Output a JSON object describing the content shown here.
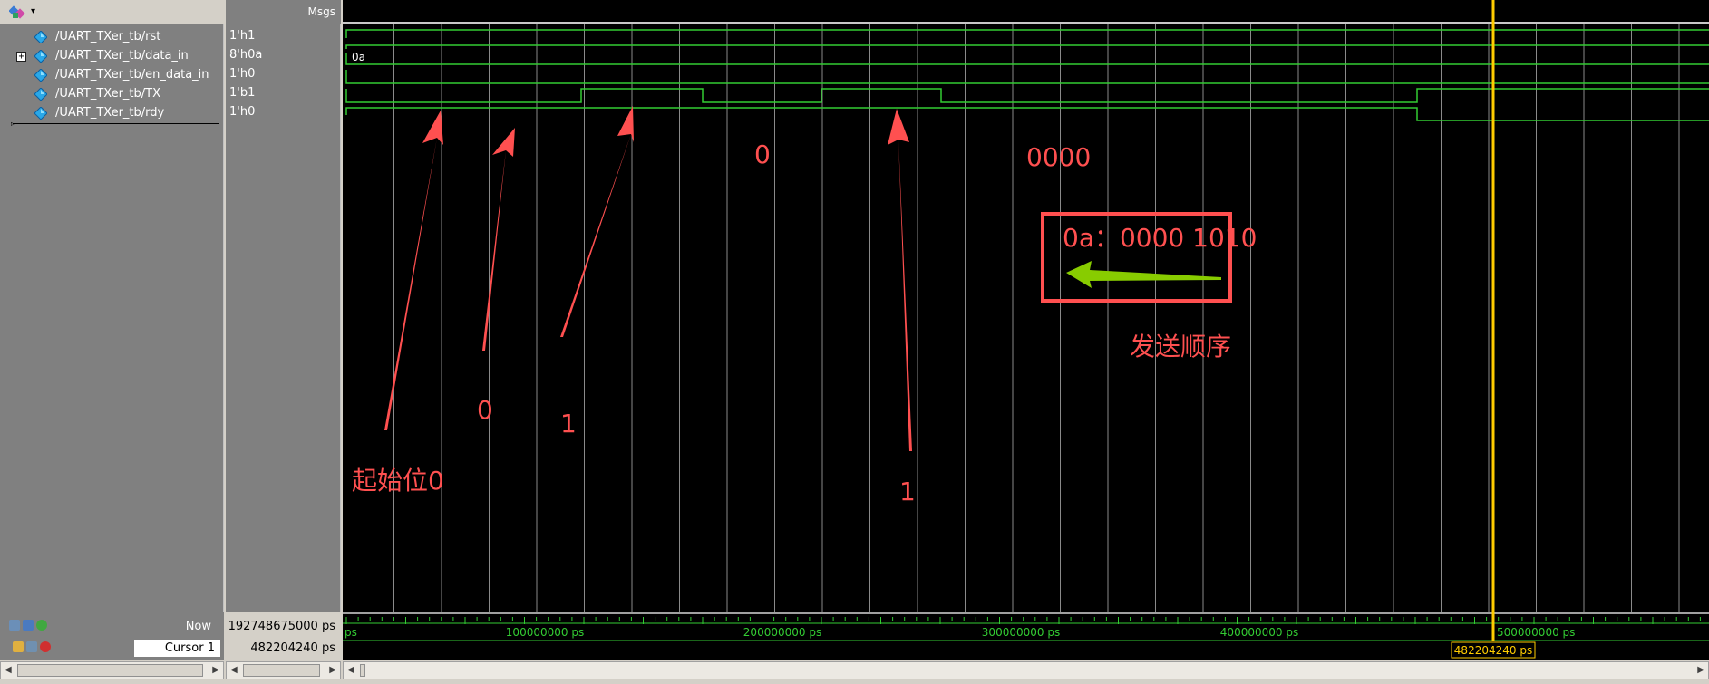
{
  "toolbar": {
    "menu_icon": "wave-tool-icon",
    "caret_icon": "chevron-down-icon"
  },
  "columns": {
    "msgs_header": "Msgs"
  },
  "signals": [
    {
      "name": "/UART_TXer_tb/rst",
      "value": "1'h1",
      "expandable": false
    },
    {
      "name": "/UART_TXer_tb/data_in",
      "value": "8'h0a",
      "expandable": true,
      "expand_label": "+"
    },
    {
      "name": "/UART_TXer_tb/en_data_in",
      "value": "1'h0",
      "expandable": false
    },
    {
      "name": "/UART_TXer_tb/TX",
      "value": "1'b1",
      "expandable": false
    },
    {
      "name": "/UART_TXer_tb/rdy",
      "value": "1'h0",
      "expandable": false
    }
  ],
  "bus_label": "0a",
  "status": {
    "now_label": "Now",
    "now_value": "192748675000 ps",
    "cursor_label": "Cursor 1",
    "cursor_value": "482204240 ps",
    "cursor_marker_label": "482204240 ps"
  },
  "timeline": {
    "tick_labels": [
      "ps",
      "100000000 ps",
      "200000000 ps",
      "300000000 ps",
      "400000000 ps",
      "500000000 ps"
    ]
  },
  "annotations": {
    "start_bit": "起始位0",
    "bit0_a": "0",
    "bit1_a": "1",
    "bit0_b": "0",
    "bits_zero": "0000",
    "bit1_b": "1",
    "box_text": "0a：0000 1010",
    "send_order": "发送顺序"
  },
  "colors": {
    "wave": "#33cc33",
    "cursor": "#ffcc00",
    "annotation": "#ff4444",
    "green_arrow": "#88cc00",
    "grid": "#8a8a8a"
  },
  "icons": [
    "wave-tool-icon",
    "chevron-down-icon",
    "signal-diamond-icon",
    "expand-plus-icon",
    "zoom-icons",
    "lock-icon",
    "wrench-icon",
    "remove-icon"
  ]
}
